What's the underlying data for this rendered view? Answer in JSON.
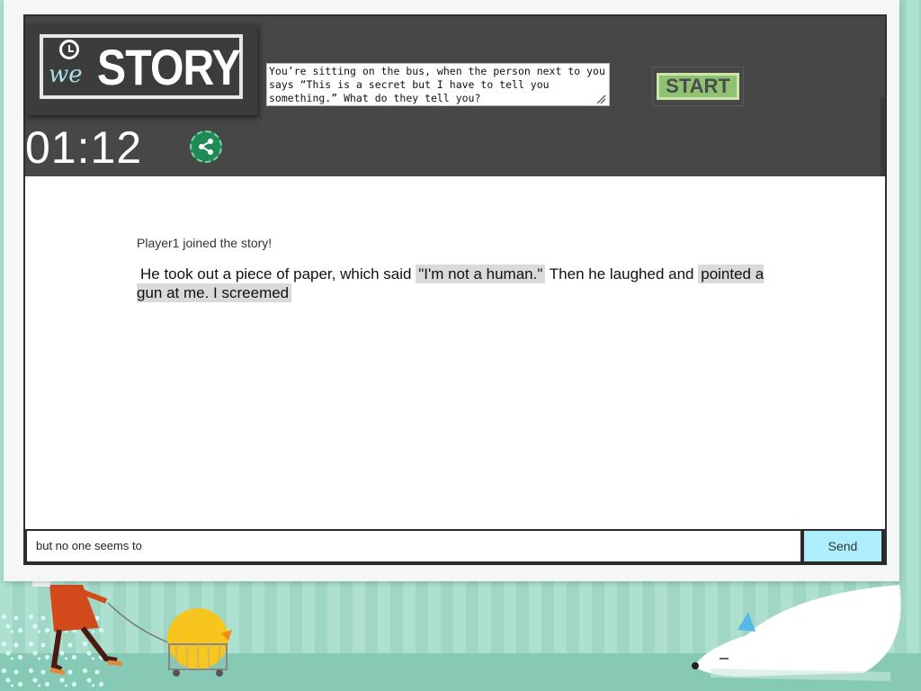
{
  "logo": {
    "we": "we",
    "story": "STORY"
  },
  "prompt": {
    "text": "You’re sitting on the bus, when the person next to you says “This is a secret but I have to tell you something.” What do they tell you?"
  },
  "start_button": {
    "label": "START"
  },
  "timer": {
    "value": "01:12"
  },
  "share": {
    "icon": "share-icon"
  },
  "story": {
    "joined_message": "Player1 joined the story!",
    "segments": [
      {
        "text": "He took out a piece of paper, which said",
        "highlighted": false
      },
      {
        "text": "\"I'm not a human.\"",
        "highlighted": true
      },
      {
        "text": "Then he laughed and",
        "highlighted": false
      },
      {
        "text": "pointed a gun at me. I screemed",
        "highlighted": true
      }
    ]
  },
  "input": {
    "value": "but no one seems to"
  },
  "send_button": {
    "label": "Send"
  },
  "colors": {
    "topbar": "#474747",
    "start": "#8fc272",
    "send": "#aeeefc",
    "share": "#1f8a55",
    "background": "#aee0d0"
  }
}
